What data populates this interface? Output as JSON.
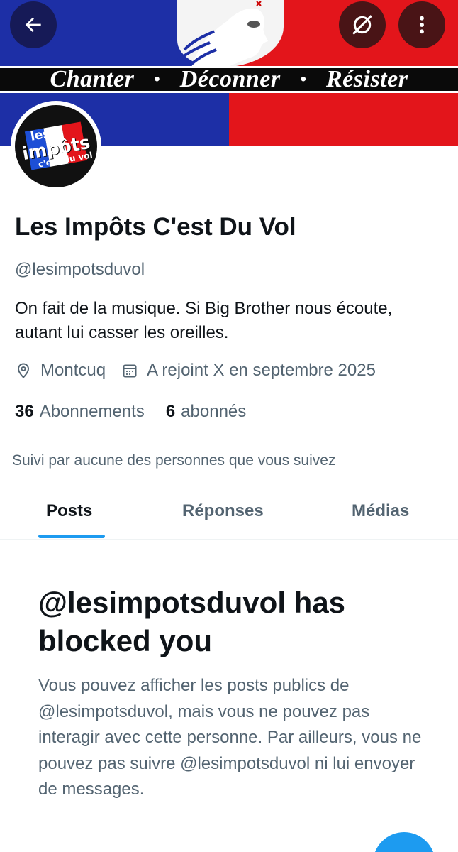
{
  "banner": {
    "words": [
      "Chanter",
      "Déconner",
      "Résister"
    ],
    "separator": "•",
    "colors": {
      "blue": "#1d2fa6",
      "red": "#e3151b",
      "white": "#f4f4f4"
    }
  },
  "top_bar": {
    "back_icon": "arrow-left-icon",
    "grok_icon": "grok-icon",
    "more_icon": "more-vertical-icon"
  },
  "avatar": {
    "line1": "les",
    "line2": "impôts",
    "line3": "c'est du vol",
    "flag_colors": [
      "#1d4fd6",
      "#ffffff",
      "#e3151b"
    ]
  },
  "profile": {
    "name": "Les Impôts C'est Du Vol",
    "handle": "@lesimpotsduvol",
    "bio": "On fait de la musique. Si Big Brother nous écoute, autant lui casser les oreilles.",
    "location": "Montcuq",
    "location_icon": "location-pin-icon",
    "joined": "A rejoint X en septembre 2025",
    "joined_icon": "calendar-icon",
    "following_count": "36",
    "following_label": "Abonnements",
    "followers_count": "6",
    "followers_label": "abonnés",
    "followed_by": "Suivi par aucune des personnes que vous suivez"
  },
  "tabs": [
    {
      "label": "Posts",
      "active": true
    },
    {
      "label": "Réponses",
      "active": false
    },
    {
      "label": "Médias",
      "active": false
    }
  ],
  "blocked": {
    "title": "@lesimpotsduvol has blocked you",
    "description": "Vous pouvez afficher les posts publics de @lesimpotsduvol, mais vous ne pouvez pas interagir avec cette personne. Par ailleurs, vous ne pouvez pas suivre @lesimpotsduvol ni lui envoyer de messages."
  },
  "accent_color": "#1d9bf0",
  "fab_icon": "compose-icon"
}
